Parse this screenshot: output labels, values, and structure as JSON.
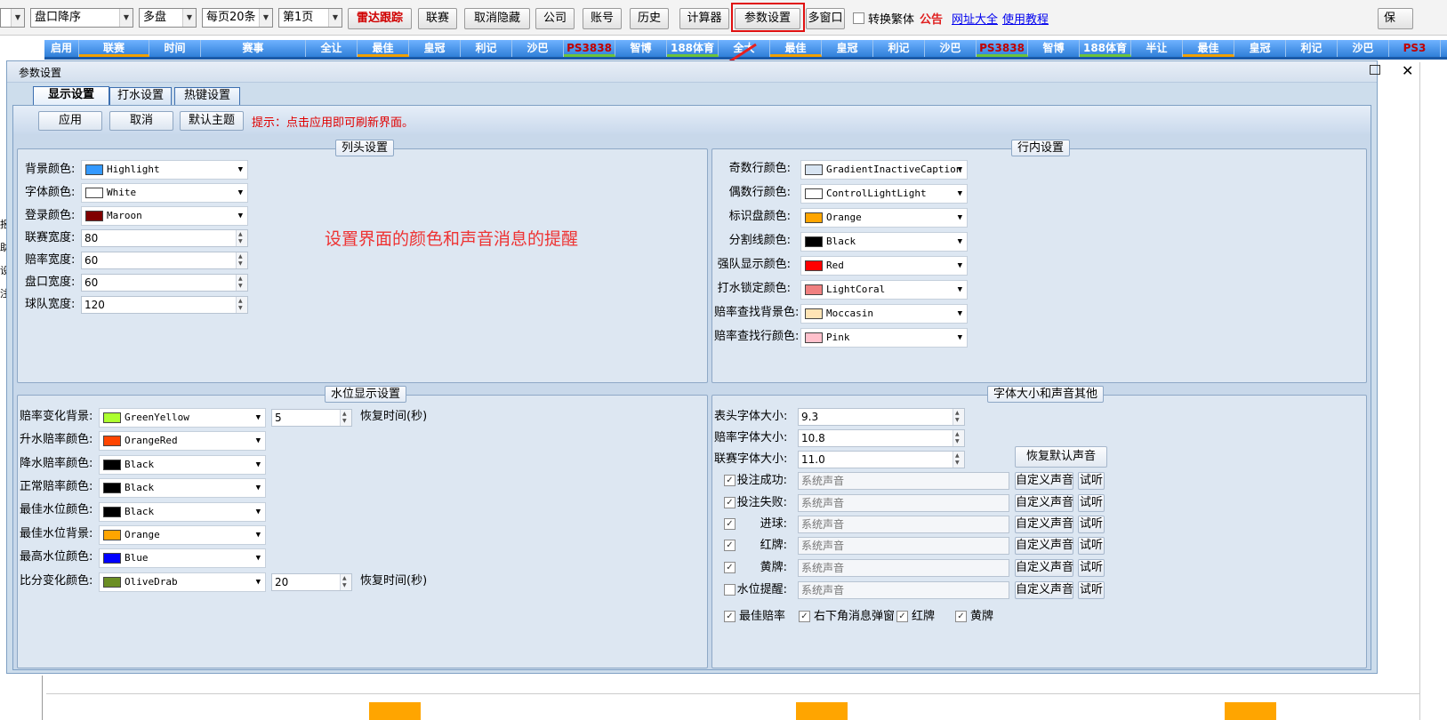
{
  "toolbar": {
    "sort_combo": "盘口降序",
    "market_combo": "多盘",
    "pagesize_combo": "每页20条",
    "page_combo": "第1页",
    "radar_button": "雷达跟踪",
    "buttons": [
      "联赛",
      "取消隐藏",
      "公司",
      "账号",
      "历史",
      "计算器",
      "参数设置",
      "多窗口"
    ],
    "traditional_label": "转换繁体",
    "notice_link": "公告",
    "sites_link": "网址大全",
    "tutorial_link": "使用教程",
    "right_cut": "保"
  },
  "header_cells": [
    "启用",
    "联赛",
    "时间",
    "赛事",
    "全让",
    "最佳",
    "皇冠",
    "利记",
    "沙巴",
    "PS3838",
    "智博",
    "188体育",
    "全大",
    "最佳",
    "皇冠",
    "利记",
    "沙巴",
    "PS3838",
    "智博",
    "188体育",
    "半让",
    "最佳",
    "皇冠",
    "利记",
    "沙巴",
    "PS3"
  ],
  "left_strip": [
    "报",
    "助",
    "设",
    "注"
  ],
  "dialog": {
    "title": "参数设置",
    "tabs": [
      "显示设置",
      "打水设置",
      "热键设置"
    ],
    "apply": "应用",
    "cancel": "取消",
    "default_theme": "默认主题",
    "hint": "提示：点击应用即可刷新界面。",
    "annotation": "设置界面的颜色和声音消息的提醒"
  },
  "column_header": {
    "title": "列头设置",
    "colors": [
      {
        "label": "背景颜色:",
        "value": "Highlight",
        "swatch": "#3399ff"
      },
      {
        "label": "字体颜色:",
        "value": "White",
        "swatch": "#ffffff"
      },
      {
        "label": "登录颜色:",
        "value": "Maroon",
        "swatch": "#800000"
      }
    ],
    "sizes": [
      {
        "label": "联赛宽度:",
        "value": "80"
      },
      {
        "label": "赔率宽度:",
        "value": "60"
      },
      {
        "label": "盘口宽度:",
        "value": "60"
      },
      {
        "label": "球队宽度:",
        "value": "120"
      }
    ]
  },
  "row_settings": {
    "title": "行内设置",
    "colors": [
      {
        "label": "奇数行颜色:",
        "value": "GradientInactiveCaption",
        "swatch": "#d7e4f2"
      },
      {
        "label": "偶数行颜色:",
        "value": "ControlLightLight",
        "swatch": "#ffffff"
      },
      {
        "label": "标识盘颜色:",
        "value": "Orange",
        "swatch": "#ffa500"
      },
      {
        "label": "分割线颜色:",
        "value": "Black",
        "swatch": "#000000"
      },
      {
        "label": "强队显示颜色:",
        "value": "Red",
        "swatch": "#ff0000"
      },
      {
        "label": "打水锁定颜色:",
        "value": "LightCoral",
        "swatch": "#f08080"
      },
      {
        "label": "赔率查找背景色:",
        "value": "Moccasin",
        "swatch": "#ffe4b5"
      },
      {
        "label": "赔率查找行颜色:",
        "value": "Pink",
        "swatch": "#ffc0cb"
      }
    ]
  },
  "water_settings": {
    "title": "水位显示设置",
    "colors": [
      {
        "label": "赔率变化背景:",
        "value": "GreenYellow",
        "swatch": "#adff2f"
      },
      {
        "label": "升水赔率颜色:",
        "value": "OrangeRed",
        "swatch": "#ff4500"
      },
      {
        "label": "降水赔率颜色:",
        "value": "Black",
        "swatch": "#000000"
      },
      {
        "label": "正常赔率颜色:",
        "value": "Black",
        "swatch": "#000000"
      },
      {
        "label": "最佳水位颜色:",
        "value": "Black",
        "swatch": "#000000"
      },
      {
        "label": "最佳水位背景:",
        "value": "Orange",
        "swatch": "#ffa500"
      },
      {
        "label": "最高水位颜色:",
        "value": "Blue",
        "swatch": "#0000ff"
      },
      {
        "label": "比分变化颜色:",
        "value": "OliveDrab",
        "swatch": "#6b8e23"
      }
    ],
    "restore1_value": "5",
    "restore2_value": "20",
    "restore_label": "恢复时间(秒)"
  },
  "font_sound": {
    "title": "字体大小和声音其他",
    "sizes": [
      {
        "label": "表头字体大小:",
        "value": "9.3"
      },
      {
        "label": "赔率字体大小:",
        "value": "10.8"
      },
      {
        "label": "联赛字体大小:",
        "value": "11.0"
      }
    ],
    "restore_sound_button": "恢复默认声音",
    "sounds": [
      {
        "label": "投注成功:",
        "value": "系统声音",
        "checked": true
      },
      {
        "label": "投注失败:",
        "value": "系统声音",
        "checked": true
      },
      {
        "label": "进球:",
        "value": "系统声音",
        "checked": true
      },
      {
        "label": "红牌:",
        "value": "系统声音",
        "checked": true
      },
      {
        "label": "黄牌:",
        "value": "系统声音",
        "checked": true
      },
      {
        "label": "水位提醒:",
        "value": "系统声音",
        "checked": false
      }
    ],
    "custom_button": "自定义声音",
    "test_button": "试听",
    "options": [
      {
        "label": "最佳赔率",
        "checked": true
      },
      {
        "label": "右下角消息弹窗",
        "checked": true
      },
      {
        "label": "红牌",
        "checked": true
      },
      {
        "label": "黄牌",
        "checked": true
      }
    ]
  }
}
